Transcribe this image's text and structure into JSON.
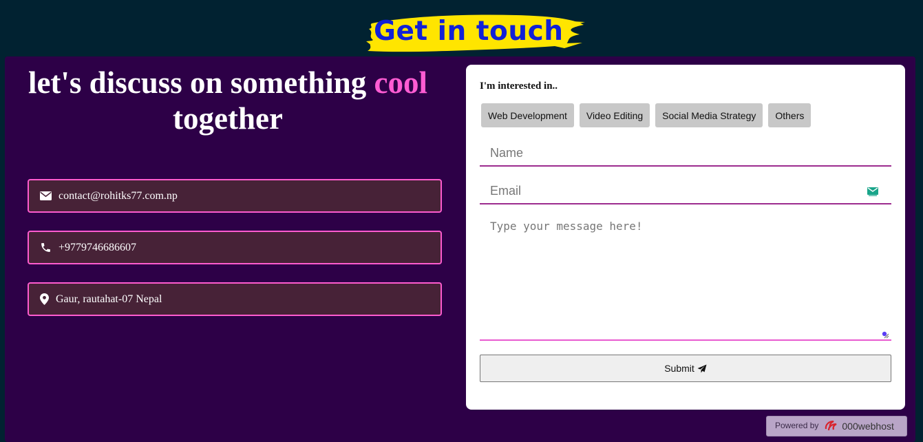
{
  "header": {
    "title": "Get in touch",
    "accent_color": "#ffe500",
    "title_color": "#1221d6"
  },
  "hero": {
    "headline_prefix": "let's discuss on something ",
    "headline_highlight": "cool",
    "headline_suffix": "together",
    "highlight_color": "#ff5cd3"
  },
  "contacts": [
    {
      "icon": "envelope-icon",
      "text": "contact@rohitks77.com.np"
    },
    {
      "icon": "phone-icon",
      "text": "+9779746686607"
    },
    {
      "icon": "map-pin-icon",
      "text": "Gaur, rautahat-07 Nepal"
    }
  ],
  "form": {
    "interest_label": "I'm interested in..",
    "interests": [
      "Web Development",
      "Video Editing",
      "Social Media Strategy",
      "Others"
    ],
    "name_placeholder": "Name",
    "email_placeholder": "Email",
    "message_placeholder": "Type your message here!",
    "submit_label": "Submit",
    "submit_icon": "paper-plane-icon"
  },
  "footer": {
    "powered_by": "Powered by",
    "host_name": "000webhost"
  },
  "colors": {
    "page_bg": "#012231",
    "panel_bg": "#2d0047",
    "card_border": "#ff5ccf",
    "card_bg": "#472237",
    "input_underline": "#9c2b8e"
  }
}
